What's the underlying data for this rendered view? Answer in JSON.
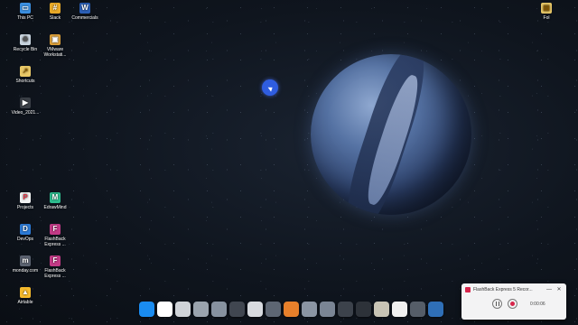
{
  "desktop": {
    "left_icons": [
      {
        "label": "This PC",
        "icon": "computer-icon",
        "color": "#3b8fe0"
      },
      {
        "label": "Slack",
        "icon": "slack-icon",
        "color": "#e8a928"
      },
      {
        "label": "Commercials",
        "icon": "word-doc-icon",
        "color": "#2b5fb6"
      },
      {
        "label": "Recycle Bin",
        "icon": "recycle-bin-icon",
        "color": "#c9d4de"
      },
      {
        "label": "VMware Workstati...",
        "icon": "vmware-icon",
        "color": "#e0a23a"
      },
      {
        "label": "Shortcuts",
        "icon": "shortcut-folder-icon",
        "color": "#e9c867"
      },
      {
        "label": "Video_2021...",
        "icon": "video-file-icon",
        "color": "#3a3f46"
      },
      {
        "label": "Projects",
        "icon": "projects-icon",
        "color": "#f2f2f2"
      },
      {
        "label": "EdrawMind",
        "icon": "edrawmind-icon",
        "color": "#2ebd8f"
      },
      {
        "label": "DevOps",
        "icon": "devops-icon",
        "color": "#2c7ad6"
      },
      {
        "label": "FlashBack Express ...",
        "icon": "flashback-icon",
        "color": "#c23a86"
      },
      {
        "label": "monday.com",
        "icon": "monday-icon",
        "color": "#5b6270"
      },
      {
        "label": "FlashBack Express ...",
        "icon": "flashback-icon",
        "color": "#c23a86"
      },
      {
        "label": "Airtable",
        "icon": "airtable-icon",
        "color": "#f4b92c"
      }
    ],
    "right_icons": [
      {
        "label": "Fol",
        "icon": "folder-icon",
        "color": "#e9c867"
      }
    ]
  },
  "dock": {
    "items": [
      {
        "name": "windows-start-icon",
        "color": "#1a8cf0"
      },
      {
        "name": "notion-icon",
        "color": "#ffffff"
      },
      {
        "name": "settings-gauge-icon",
        "color": "#cfd3d8"
      },
      {
        "name": "recycle-bin-icon",
        "color": "#9aa3ad"
      },
      {
        "name": "weather-widget-icon",
        "color": "#8792a0"
      },
      {
        "name": "dark-tile-icon",
        "color": "#404650"
      },
      {
        "name": "clock-widget-icon",
        "color": "#d8dbe0"
      },
      {
        "name": "weather-widget-icon",
        "color": "#5d6673"
      },
      {
        "name": "orange-app-icon",
        "color": "#e7802b"
      },
      {
        "name": "photo-app-icon",
        "color": "#8b95a3"
      },
      {
        "name": "weather-widget-icon",
        "color": "#7a8594"
      },
      {
        "name": "stats-widget-icon",
        "color": "#3c424b"
      },
      {
        "name": "disk-monitor-icon",
        "color": "#2d3239"
      },
      {
        "name": "globe-app-icon",
        "color": "#c8c4b5"
      },
      {
        "name": "mail-app-icon",
        "color": "#f0f0f0"
      },
      {
        "name": "camera-app-icon",
        "color": "#555d68"
      },
      {
        "name": "browser-icon",
        "color": "#2f6fb7"
      }
    ]
  },
  "recorder": {
    "title": "FlashBack Express 5 Recor...",
    "minimize": "—",
    "close": "✕",
    "timer": "0:00:06"
  }
}
